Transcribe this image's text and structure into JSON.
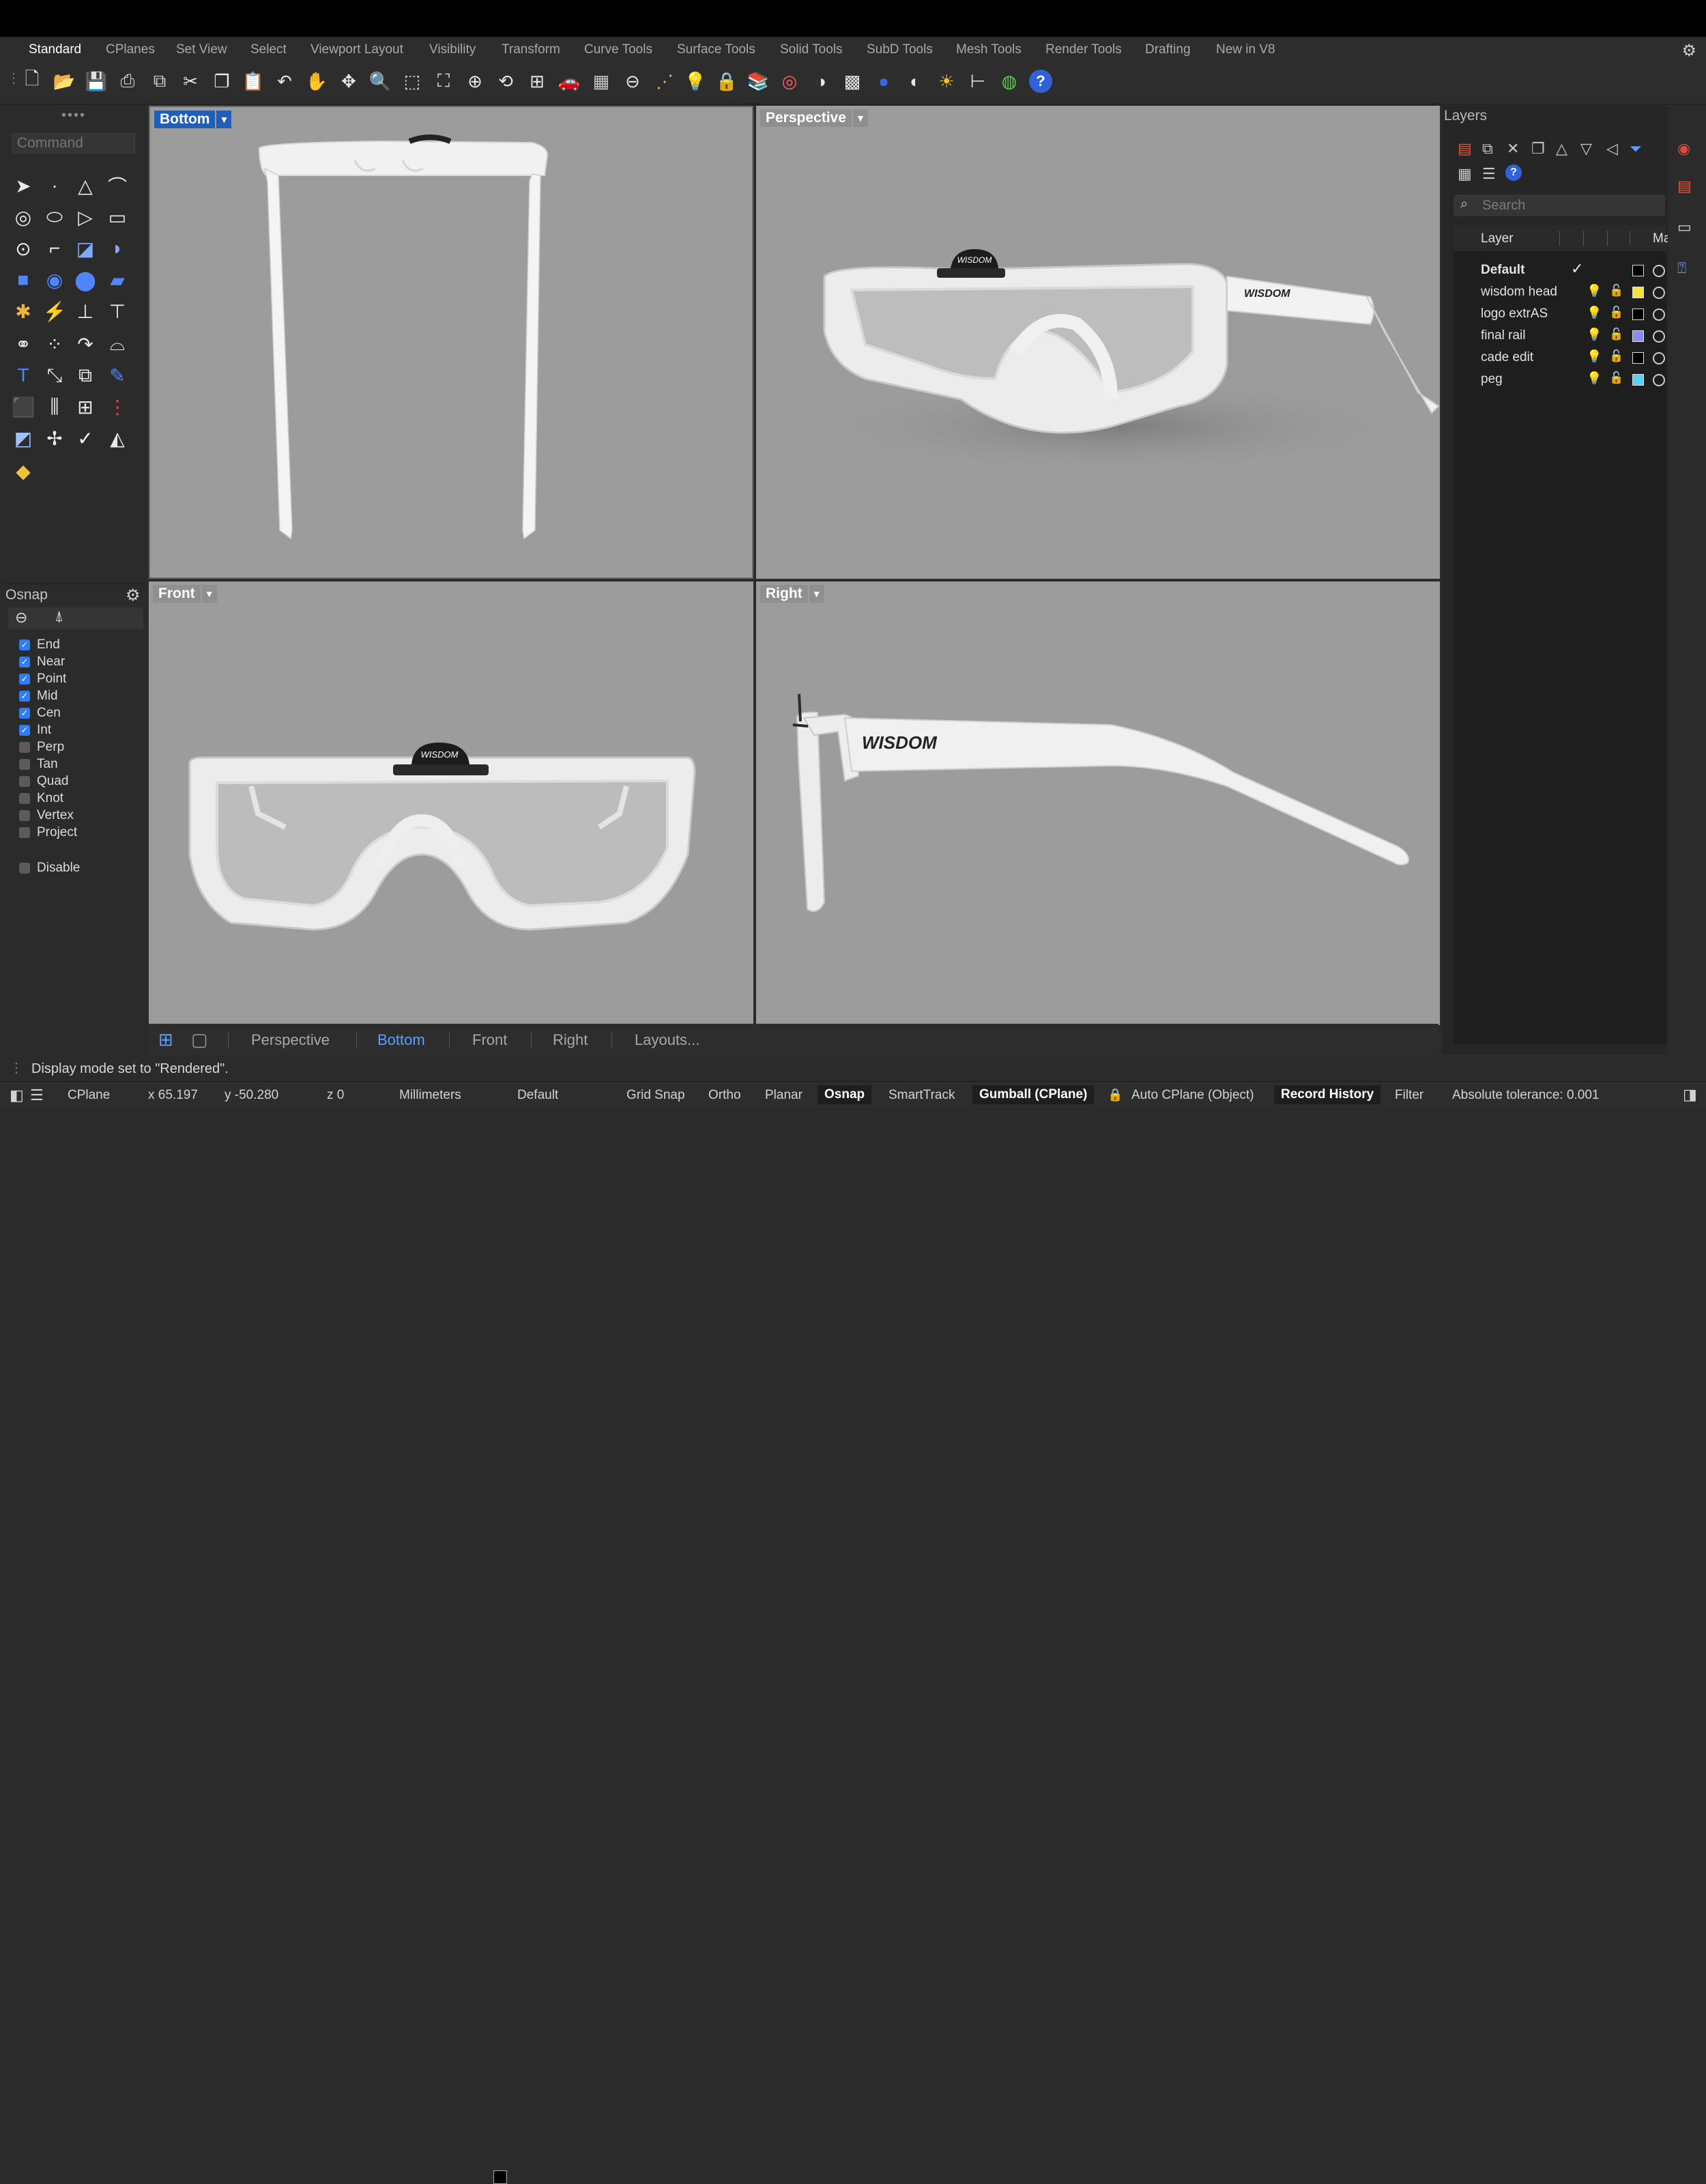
{
  "menu_tabs": [
    "Standard",
    "CPlanes",
    "Set View",
    "Select",
    "Viewport Layout",
    "Visibility",
    "Transform",
    "Curve Tools",
    "Surface Tools",
    "Solid Tools",
    "SubD Tools",
    "Mesh Tools",
    "Render Tools",
    "Drafting",
    "New in V8"
  ],
  "active_tab": "Standard",
  "command": {
    "placeholder": "Command"
  },
  "osnap": {
    "title": "Osnap",
    "items": [
      {
        "label": "End",
        "checked": true
      },
      {
        "label": "Near",
        "checked": true
      },
      {
        "label": "Point",
        "checked": true
      },
      {
        "label": "Mid",
        "checked": true
      },
      {
        "label": "Cen",
        "checked": true
      },
      {
        "label": "Int",
        "checked": true
      },
      {
        "label": "Perp",
        "checked": false
      },
      {
        "label": "Tan",
        "checked": false
      },
      {
        "label": "Quad",
        "checked": false
      },
      {
        "label": "Knot",
        "checked": false
      },
      {
        "label": "Vertex",
        "checked": false
      },
      {
        "label": "Project",
        "checked": false
      }
    ],
    "disable": {
      "label": "Disable",
      "checked": false
    }
  },
  "viewports": {
    "top_left": "Bottom",
    "top_right": "Perspective",
    "bottom_left": "Front",
    "bottom_right": "Right"
  },
  "view_tabs": [
    "Perspective",
    "Bottom",
    "Front",
    "Right",
    "Layouts..."
  ],
  "active_view_tab": "Bottom",
  "layers": {
    "title": "Layers",
    "search_placeholder": "Search",
    "col_layer": "Layer",
    "col_material": "Ma",
    "rows": [
      {
        "name": "Default",
        "current": true,
        "color": "#000000"
      },
      {
        "name": "wisdom head",
        "current": false,
        "color": "#f5e23c"
      },
      {
        "name": "logo extrAS",
        "current": false,
        "color": "#000000"
      },
      {
        "name": "final rail",
        "current": false,
        "color": "#8a8cf5"
      },
      {
        "name": "cade edit",
        "current": false,
        "color": "#000000"
      },
      {
        "name": "peg",
        "current": false,
        "color": "#5ad0f5"
      }
    ]
  },
  "command_history": "Display mode set to \"Rendered\".",
  "status": {
    "cplane": "CPlane",
    "x": "x 65.197",
    "y": "y -50.280",
    "z": "z 0",
    "units": "Millimeters",
    "layer": "Default",
    "grid_snap": "Grid Snap",
    "ortho": "Ortho",
    "planar": "Planar",
    "osnap": "Osnap",
    "smarttrack": "SmartTrack",
    "gumball": "Gumball (CPlane)",
    "auto_cplane": "Auto CPlane (Object)",
    "record_history": "Record History",
    "filter": "Filter",
    "tolerance": "Absolute tolerance: 0.001"
  },
  "logo_text": "WISDOM",
  "colors": {
    "accent": "#2f7cf6",
    "active_view_title": "#1f5fb8",
    "viewport_bg": "#9c9c9c"
  }
}
